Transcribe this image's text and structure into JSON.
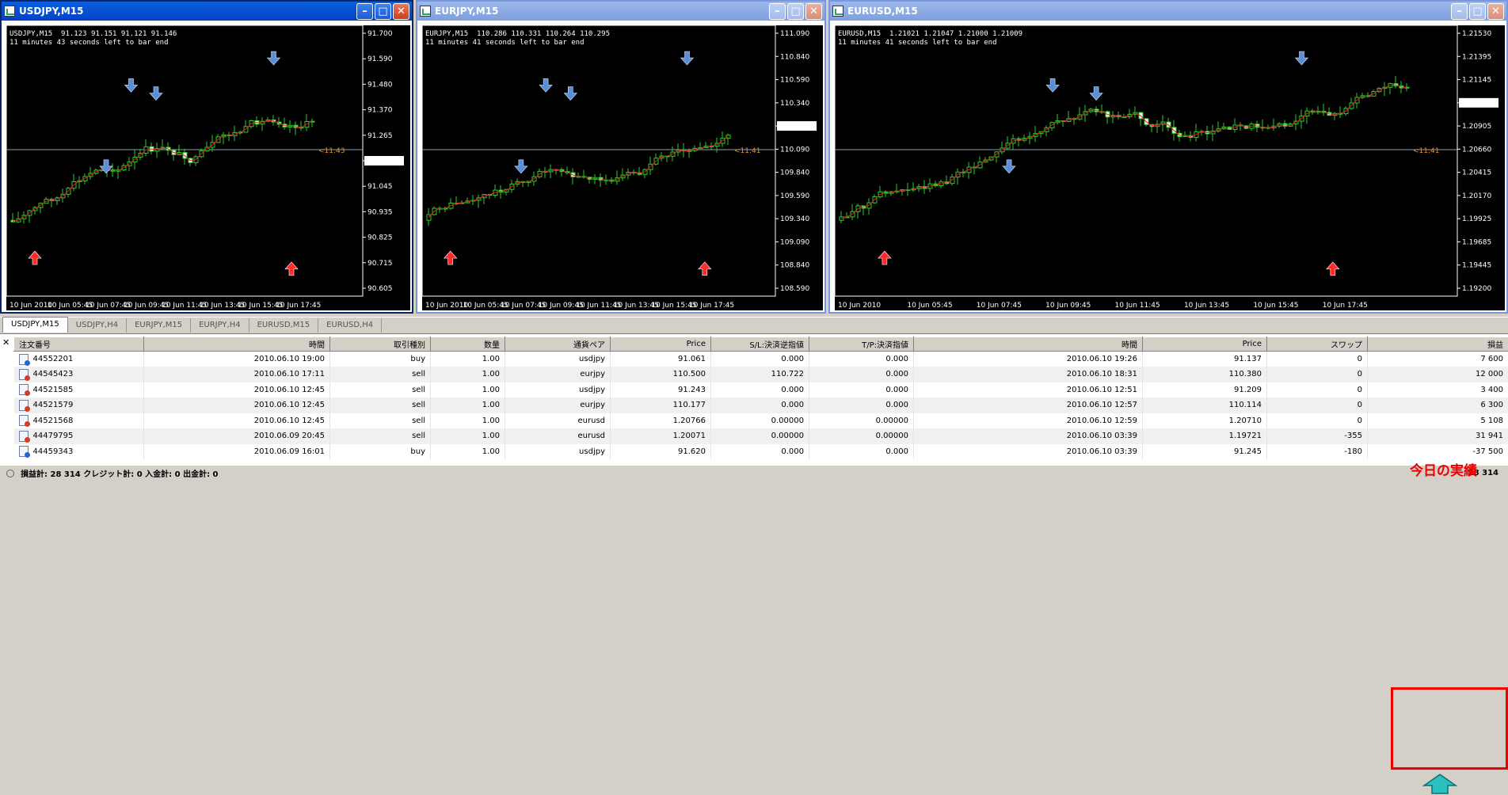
{
  "charts": [
    {
      "key": "c1",
      "title": "USDJPY,M15",
      "info1": "USDJPY,M15  91.123 91.151 91.121 91.146",
      "info2": "11 minutes 43 seconds left to bar end",
      "price_labels": [
        "91.700",
        "91.590",
        "91.480",
        "91.370",
        "91.265",
        "91.146",
        "91.045",
        "90.935",
        "90.825",
        "90.715",
        "90.605"
      ],
      "current_price": "91.146",
      "countdown": "<11:43",
      "time_labels": [
        "10 Jun 2010",
        "10 Jun 05:45",
        "10 Jun 07:45",
        "10 Jun 09:45",
        "10 Jun 11:45",
        "10 Jun 13:45",
        "10 Jun 15:45",
        "10 Jun 17:45"
      ]
    },
    {
      "key": "c2",
      "title": "EURJPY,M15",
      "info1": "EURJPY,M15  110.286 110.331 110.264 110.295",
      "info2": "11 minutes 41 seconds left to bar end",
      "price_labels": [
        "111.090",
        "110.840",
        "110.590",
        "110.340",
        "110.295",
        "110.090",
        "109.840",
        "109.590",
        "109.340",
        "109.090",
        "108.840",
        "108.590"
      ],
      "current_price": "110.295",
      "countdown": "<11:41",
      "time_labels": [
        "10 Jun 2010",
        "10 Jun 05:45",
        "10 Jun 07:45",
        "10 Jun 09:45",
        "10 Jun 11:45",
        "10 Jun 13:45",
        "10 Jun 15:45",
        "10 Jun 17:45"
      ]
    },
    {
      "key": "c3",
      "title": "EURUSD,M15",
      "info1": "EURUSD,M15  1.21021 1.21047 1.21000 1.21009",
      "info2": "11 minutes 41 seconds left to bar end",
      "price_labels": [
        "1.21530",
        "1.21395",
        "1.21145",
        "1.21009",
        "1.20905",
        "1.20660",
        "1.20415",
        "1.20170",
        "1.19925",
        "1.19685",
        "1.19445",
        "1.19200"
      ],
      "current_price": "1.21009",
      "countdown": "<11:41",
      "time_labels": [
        "10 Jun 2010",
        "10 Jun 05:45",
        "10 Jun 07:45",
        "10 Jun 09:45",
        "10 Jun 11:45",
        "10 Jun 13:45",
        "10 Jun 15:45",
        "10 Jun 17:45"
      ]
    }
  ],
  "tabs": [
    "USDJPY,M15",
    "USDJPY,H4",
    "EURJPY,M15",
    "EURJPY,H4",
    "EURUSD,M15",
    "EURUSD,H4"
  ],
  "table": {
    "headers": [
      "注文番号",
      "時間",
      "取引種別",
      "数量",
      "通貨ペア",
      "Price",
      "S/L:決済逆指値",
      "T/P:決済指値",
      "時間",
      "Price",
      "スワップ",
      "損益"
    ],
    "rows": [
      [
        "44552201",
        "2010.06.10 19:00",
        "buy",
        "1.00",
        "usdjpy",
        "91.061",
        "0.000",
        "0.000",
        "2010.06.10 19:26",
        "91.137",
        "0",
        "7 600"
      ],
      [
        "44545423",
        "2010.06.10 17:11",
        "sell",
        "1.00",
        "eurjpy",
        "110.500",
        "110.722",
        "0.000",
        "2010.06.10 18:31",
        "110.380",
        "0",
        "12 000"
      ],
      [
        "44521585",
        "2010.06.10 12:45",
        "sell",
        "1.00",
        "usdjpy",
        "91.243",
        "0.000",
        "0.000",
        "2010.06.10 12:51",
        "91.209",
        "0",
        "3 400"
      ],
      [
        "44521579",
        "2010.06.10 12:45",
        "sell",
        "1.00",
        "eurjpy",
        "110.177",
        "0.000",
        "0.000",
        "2010.06.10 12:57",
        "110.114",
        "0",
        "6 300"
      ],
      [
        "44521568",
        "2010.06.10 12:45",
        "sell",
        "1.00",
        "eurusd",
        "1.20766",
        "0.00000",
        "0.00000",
        "2010.06.10 12:59",
        "1.20710",
        "0",
        "5 108"
      ],
      [
        "44479795",
        "2010.06.09 20:45",
        "sell",
        "1.00",
        "eurusd",
        "1.20071",
        "0.00000",
        "0.00000",
        "2010.06.10 03:39",
        "1.19721",
        "-355",
        "31 941"
      ],
      [
        "44459343",
        "2010.06.09 16:01",
        "buy",
        "1.00",
        "usdjpy",
        "91.620",
        "0.000",
        "0.000",
        "2010.06.10 03:39",
        "91.245",
        "-180",
        "-37 500"
      ]
    ]
  },
  "status": "損益計: 28 314  クレジット計: 0  入金計: 0  出金計: 0",
  "status_total": "28 314",
  "annotation": "今日の実績"
}
